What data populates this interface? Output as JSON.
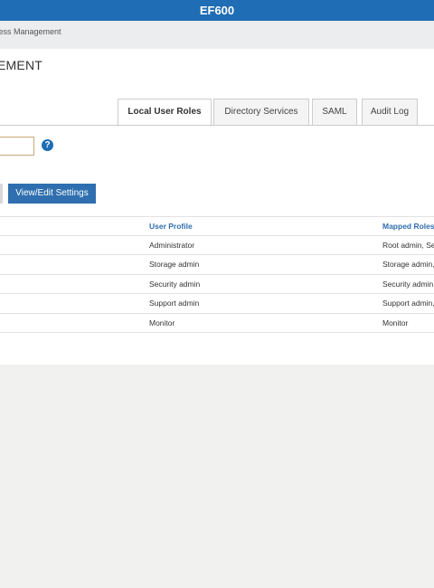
{
  "app": {
    "title": "EF600"
  },
  "breadcrumb": {
    "text": "cess Management"
  },
  "page": {
    "title": "EMENT"
  },
  "tabs": [
    {
      "label": "Local User Roles",
      "active": true
    },
    {
      "label": "Directory Services",
      "active": false
    },
    {
      "label": "SAML",
      "active": false
    },
    {
      "label": "Audit Log",
      "active": false
    }
  ],
  "help_icon": {
    "glyph": "?"
  },
  "actions": {
    "view_edit_label": "View/Edit Settings"
  },
  "table": {
    "headers": {
      "user_profile": "User Profile",
      "mapped_roles": "Mapped Roles"
    },
    "rows": [
      {
        "user_profile": "Administrator",
        "mapped_roles": "Root admin, Se"
      },
      {
        "user_profile": "Storage admin",
        "mapped_roles": "Storage admin,"
      },
      {
        "user_profile": "Security admin",
        "mapped_roles": "Security admin"
      },
      {
        "user_profile": "Support admin",
        "mapped_roles": "Support admin,"
      },
      {
        "user_profile": "Monitor",
        "mapped_roles": "Monitor"
      }
    ]
  },
  "colors": {
    "brand": "#1f6db4",
    "button": "#2f6faf",
    "header_text": "#2f6faf"
  }
}
